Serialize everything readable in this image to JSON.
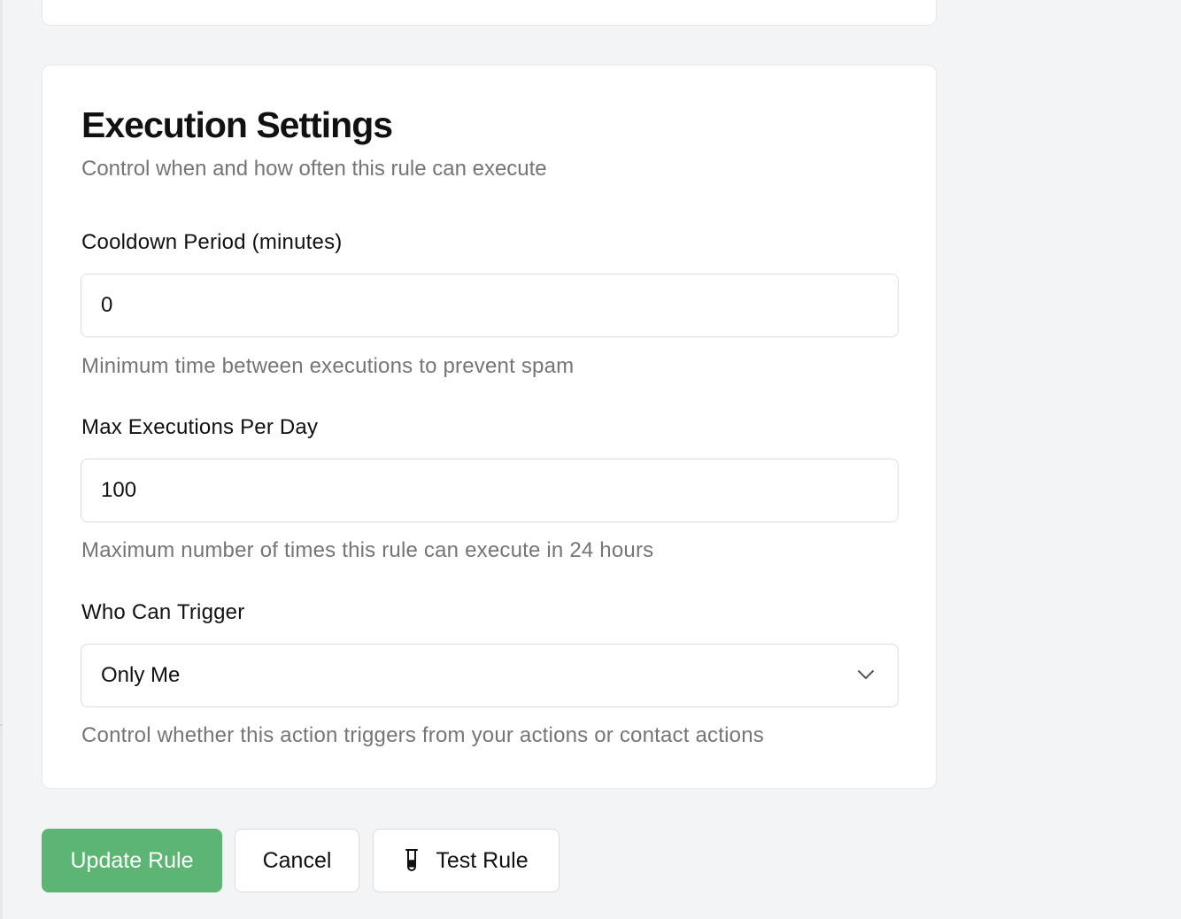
{
  "execution_settings": {
    "title": "Execution Settings",
    "description": "Control when and how often this rule can execute",
    "cooldown": {
      "label": "Cooldown Period (minutes)",
      "value": "0",
      "help": "Minimum time between executions to prevent spam"
    },
    "max_executions": {
      "label": "Max Executions Per Day",
      "value": "100",
      "help": "Maximum number of times this rule can execute in 24 hours"
    },
    "who_can_trigger": {
      "label": "Who Can Trigger",
      "selected": "Only Me",
      "help": "Control whether this action triggers from your actions or contact actions"
    }
  },
  "actions": {
    "update_label": "Update Rule",
    "cancel_label": "Cancel",
    "test_label": "Test Rule"
  },
  "icons": {
    "test": "test-tube-icon",
    "dropdown": "chevron-down-icon"
  },
  "colors": {
    "primary": "#5db574",
    "background": "#f3f4f6",
    "muted_text": "#757575"
  }
}
